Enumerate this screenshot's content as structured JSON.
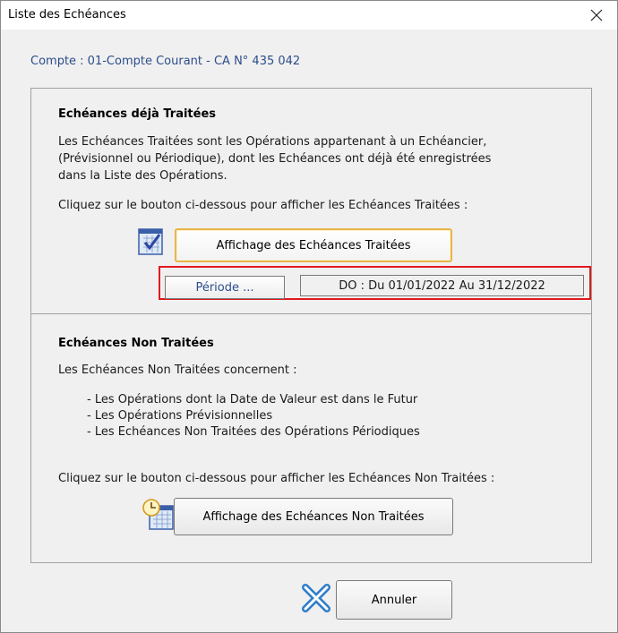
{
  "window": {
    "title": "Liste des Echéances"
  },
  "account_label": "Compte : 01-Compte Courant - CA N° 435 042",
  "treated": {
    "heading": "Echéances déjà Traitées",
    "description_lines": [
      "Les Echéances Traitées sont les Opérations appartenant à un Echéancier,",
      "(Prévisionnel ou Périodique), dont les Echéances ont déjà été enregistrées",
      "dans la Liste des Opérations."
    ],
    "instruction": "Cliquez sur le bouton ci-dessous pour afficher les Echéances Traitées :",
    "button_label": "Affichage des Echéances Traitées",
    "period_button_label": "Période ...",
    "period_value": "DO : Du 01/01/2022 Au 31/12/2022"
  },
  "untreated": {
    "heading": "Echéances Non Traitées",
    "intro": "Les Echéances Non Traitées concernent :",
    "items": [
      "- Les Opérations dont la Date de Valeur est dans le Futur",
      "- Les Opérations Prévisionnelles",
      "- Les Echéances Non Traitées des Opérations Périodiques"
    ],
    "instruction": "Cliquez sur le bouton ci-dessous pour afficher les Echéances Non Traitées :",
    "button_label": "Affichage des Echéances Non Traitées"
  },
  "footer": {
    "cancel_label": "Annuler"
  },
  "icons": {
    "close": "close-icon",
    "treated": "checked-calendar-icon",
    "untreated": "clock-calendar-icon",
    "cancel": "cancel-x-icon"
  },
  "colors": {
    "accent_blue": "#2c4d8a",
    "highlight_red": "#e0191e",
    "focus_orange": "#e8b44a"
  }
}
